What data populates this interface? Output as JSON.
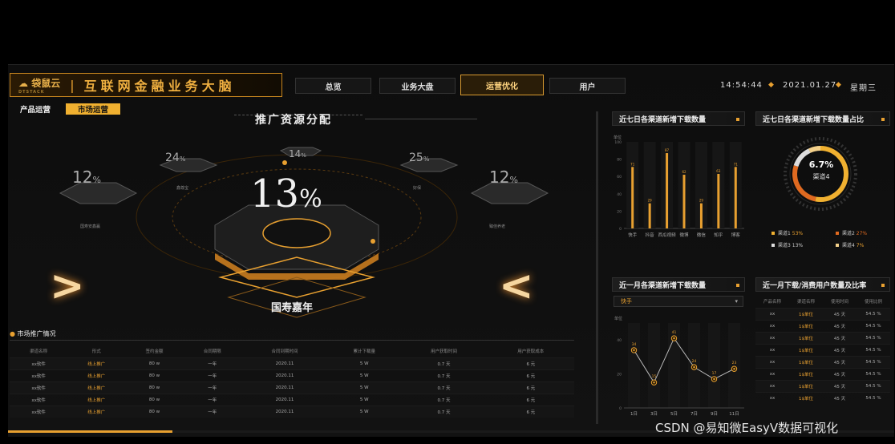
{
  "header": {
    "logo": "袋鼠云",
    "logo_sub": "DTSTACK",
    "title": "互联网金融业务大脑",
    "tabs": [
      "总览",
      "业务大盘",
      "运营优化",
      "用户"
    ],
    "active_tab": 2,
    "time": "14:54:44",
    "date": "2021.01.27",
    "weekday": "星期三"
  },
  "subtabs": [
    "产品运营",
    "市场运营"
  ],
  "center": {
    "title": "推广资源分配",
    "main_pct": "13",
    "pct_sym": "%",
    "main_label": "国寿嘉年",
    "side_items": [
      {
        "pct": "12",
        "sym": "%",
        "label": "国寿安鑫赢"
      },
      {
        "pct": "24",
        "sym": "%",
        "label": "鑫尊宝"
      },
      {
        "pct": "14",
        "sym": "%",
        "label": "国寿鑫享宝"
      },
      {
        "pct": "25",
        "sym": "%",
        "label": "好保"
      },
      {
        "pct": "12",
        "sym": "%",
        "label": "臻佳养老"
      }
    ]
  },
  "market": {
    "title": "市场推广情况",
    "headers": [
      "渠道名称",
      "形式",
      "签约金额",
      "合同期限",
      "合同到期时间",
      "累计下载量",
      "用户获取时间",
      "用户获取成本"
    ],
    "rows": [
      [
        "xx软件",
        "线上推广",
        "80 w",
        "一年",
        "2020.11",
        "5 W",
        "0.7 天",
        "6 元"
      ],
      [
        "xx软件",
        "线上推广",
        "80 w",
        "一年",
        "2020.11",
        "5 W",
        "0.7 天",
        "6 元"
      ],
      [
        "xx软件",
        "线上推广",
        "80 w",
        "一年",
        "2020.11",
        "5 W",
        "0.7 天",
        "6 元"
      ],
      [
        "xx软件",
        "线上推广",
        "80 w",
        "一年",
        "2020.11",
        "5 W",
        "0.7 天",
        "6 元"
      ],
      [
        "xx软件",
        "线上推广",
        "80 w",
        "一年",
        "2020.11",
        "5 W",
        "0.7 天",
        "6 元"
      ]
    ]
  },
  "panel1": {
    "title": "近七日各渠道新增下载数量",
    "unit": "单位"
  },
  "panel2": {
    "title": "近七日各渠道新增下载数量占比",
    "center_pct": "6.7%",
    "center_label": "渠道4",
    "legend": [
      {
        "name": "渠道1",
        "pct": "53%",
        "color": "#f0b030"
      },
      {
        "name": "渠道2",
        "pct": "27%",
        "color": "#e06a20"
      },
      {
        "name": "渠道3",
        "pct": "13%",
        "color": "#dddddd"
      },
      {
        "name": "渠道4",
        "pct": "7%",
        "color": "#f3d08a"
      }
    ]
  },
  "panel3": {
    "title": "近一月各渠道新增下载数量",
    "dropdown": "快手",
    "unit": "单位"
  },
  "panel4": {
    "title": "近一月下载/消费用户数量及比率",
    "headers": [
      "产品名称",
      "渠道名称",
      "使用时间",
      "使用比例"
    ],
    "rows": [
      [
        "xx",
        "1$单位",
        "45 天",
        "54.5 %"
      ],
      [
        "xx",
        "1$单位",
        "45 天",
        "54.5 %"
      ],
      [
        "xx",
        "1$单位",
        "45 天",
        "54.5 %"
      ],
      [
        "xx",
        "1$单位",
        "45 天",
        "54.5 %"
      ],
      [
        "xx",
        "1$单位",
        "45 天",
        "54.5 %"
      ],
      [
        "xx",
        "1$单位",
        "45 天",
        "54.5 %"
      ],
      [
        "xx",
        "1$单位",
        "45 天",
        "54.5 %"
      ],
      [
        "xx",
        "1$单位",
        "45 天",
        "54.5 %"
      ]
    ]
  },
  "chart_data": [
    {
      "type": "bar",
      "title": "近七日各渠道新增下载数量",
      "categories": [
        "快手",
        "抖音",
        "西瓜视频",
        "微博",
        "微信",
        "知乎",
        "博客"
      ],
      "values": [
        71,
        29,
        87,
        62,
        29,
        63,
        71
      ],
      "ylim": [
        0,
        100
      ],
      "yticks": [
        0,
        20,
        40,
        60,
        80,
        100
      ]
    },
    {
      "type": "pie",
      "title": "近七日各渠道新增下载数量占比",
      "labels": [
        "渠道1",
        "渠道2",
        "渠道3",
        "渠道4"
      ],
      "values": [
        53,
        27,
        13,
        7
      ]
    },
    {
      "type": "line",
      "title": "近一月各渠道新增下载数量",
      "categories": [
        "1日",
        "3日",
        "5日",
        "7日",
        "9日",
        "11日"
      ],
      "values": [
        34,
        15,
        41,
        24,
        17,
        23
      ],
      "ylim": [
        0,
        50
      ],
      "yticks": [
        0,
        10,
        20,
        30,
        40,
        50
      ]
    }
  ],
  "watermark": "CSDN @易知微EasyV数据可视化"
}
